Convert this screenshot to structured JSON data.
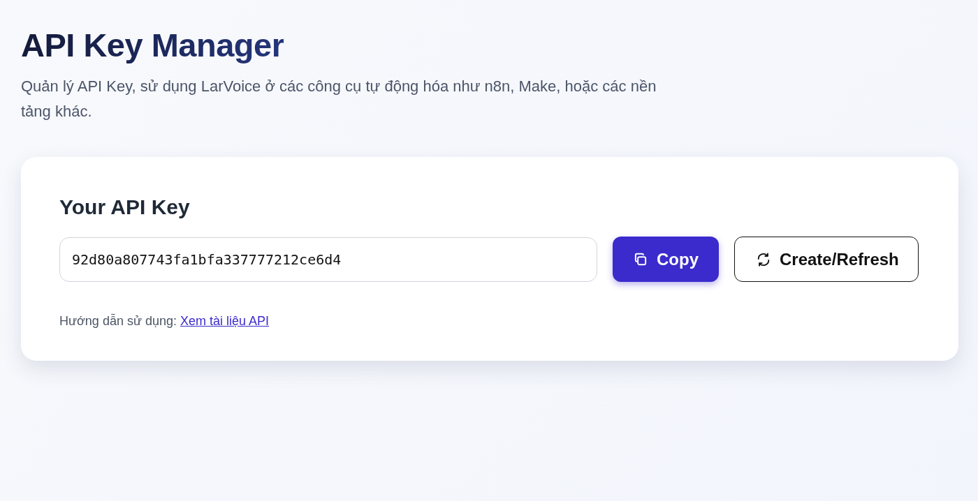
{
  "header": {
    "title": "API Key Manager",
    "subtitle": "Quản lý API Key, sử dụng LarVoice ở các công cụ tự động hóa như n8n, Make, hoặc các nền tảng khác."
  },
  "card": {
    "heading": "Your API Key",
    "api_key": {
      "value": "92d80a807743fa1bfa337777212ce6d4"
    },
    "buttons": [
      {
        "kind": "primary",
        "label": "Copy"
      },
      {
        "kind": "outline",
        "label": "Create/Refresh"
      }
    ],
    "help": {
      "text": "Hướng dẫn sử dụng: ",
      "link": "Xem tài liệu API"
    }
  }
}
